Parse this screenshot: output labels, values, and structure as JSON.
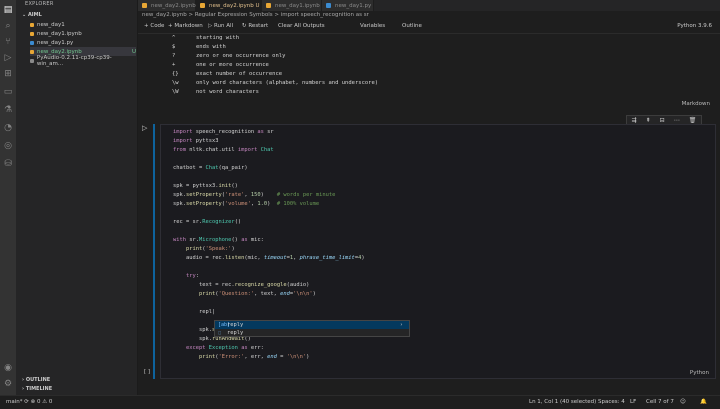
{
  "activity_icons": [
    "files-icon",
    "search-icon",
    "source-control-icon",
    "run-debug-icon",
    "extensions-icon",
    "remote-explorer-icon",
    "testing-icon",
    "jupyter-icon",
    "docker-icon",
    "database-icon",
    "account-icon",
    "settings-icon"
  ],
  "sidebar": {
    "title": "EXPLORER",
    "section": "AIML",
    "files": [
      {
        "name": "new_day1",
        "badge": ""
      },
      {
        "name": "new_day1.ipynb",
        "badge": ""
      },
      {
        "name": "new_day1.py",
        "badge": ""
      },
      {
        "name": "new_day2.ipynb",
        "badge": "U"
      },
      {
        "name": "PyAudio-0.2.11-cp39-cp39-win_am...",
        "badge": ""
      }
    ],
    "outline": "OUTLINE",
    "timeline": "TIMELINE"
  },
  "tabs": [
    {
      "label": "new_day2.ipynb"
    },
    {
      "label": "new_day2.ipynb U"
    },
    {
      "label": "new_day1.ipynb"
    },
    {
      "label": "new_day1.py"
    }
  ],
  "breadcrumbs": "new_day2.ipynb > Regular Expression Symbols > import speech_recognition as sr",
  "toolbar": {
    "code": "+ Code",
    "markdown": "+ Markdown",
    "run_all": "▷ Run All",
    "restart": "↻ Restart",
    "clear": "Clear All Outputs",
    "variables": "Variables",
    "outline": "Outline",
    "kernel": "Python 3.9.6"
  },
  "markdown_rows": [
    {
      "sym": "^",
      "desc": "starting with"
    },
    {
      "sym": "$",
      "desc": "ends with"
    },
    {
      "sym": "?",
      "desc": "zero or one occurrence only"
    },
    {
      "sym": "+",
      "desc": "one or more occurrence"
    },
    {
      "sym": "{}",
      "desc": "exact number of occurrence"
    },
    {
      "sym": "\\w",
      "desc": "only word characters (alphabet, numbers and underscore)"
    },
    {
      "sym": "\\W",
      "desc": "not word characters"
    }
  ],
  "markdown_label": "Markdown",
  "code_language": "Python",
  "cell_exec_marker": "[ ]",
  "autocomplete": {
    "typed": "repl",
    "items": [
      "reply",
      "reply"
    ]
  },
  "status": {
    "branch": "main*",
    "sync": "⟳",
    "problems": "⊗ 0 ⚠ 0",
    "position": "Ln 1, Col 1 (40 selected)",
    "spaces": "Spaces: 4",
    "eol": "LF",
    "cell": "Cell 7 of 7"
  }
}
